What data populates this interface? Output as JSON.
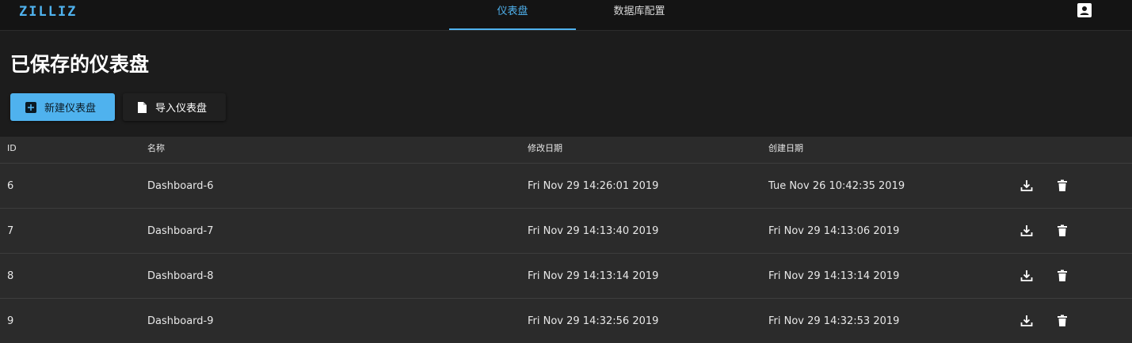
{
  "app": {
    "logo": "ZILLIZ",
    "tabs": [
      {
        "label": "仪表盘",
        "active": true
      },
      {
        "label": "数据库配置",
        "active": false
      }
    ],
    "accent_color": "#4fb2ee"
  },
  "header": {
    "title": "已保存的仪表盘",
    "new_button": "新建仪表盘",
    "import_button": "导入仪表盘"
  },
  "table": {
    "columns": [
      "ID",
      "名称",
      "修改日期",
      "创建日期"
    ],
    "rows": [
      {
        "id": "6",
        "name": "Dashboard-6",
        "modified": "Fri Nov 29 14:26:01 2019",
        "created": "Tue Nov 26 10:42:35 2019"
      },
      {
        "id": "7",
        "name": "Dashboard-7",
        "modified": "Fri Nov 29 14:13:40 2019",
        "created": "Fri Nov 29 14:13:06 2019"
      },
      {
        "id": "8",
        "name": "Dashboard-8",
        "modified": "Fri Nov 29 14:13:14 2019",
        "created": "Fri Nov 29 14:13:14 2019"
      },
      {
        "id": "9",
        "name": "Dashboard-9",
        "modified": "Fri Nov 29 14:32:56 2019",
        "created": "Fri Nov 29 14:32:53 2019"
      }
    ],
    "row_actions": [
      "download-icon",
      "delete-icon"
    ]
  }
}
